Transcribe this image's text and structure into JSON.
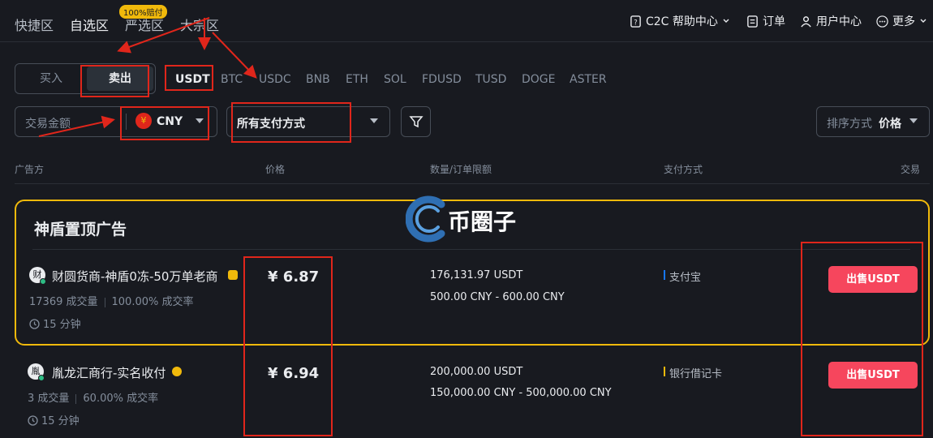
{
  "nav": {
    "tabs": [
      "快捷区",
      "自选区",
      "严选区",
      "大宗区"
    ],
    "badge": "100%赔付",
    "right": {
      "help": "C2C 帮助中心",
      "orders": "订单",
      "user_center": "用户中心",
      "more": "更多"
    }
  },
  "trade_toggle": {
    "buy": "买入",
    "sell": "卖出"
  },
  "coins": [
    "USDT",
    "BTC",
    "USDC",
    "BNB",
    "ETH",
    "SOL",
    "FDUSD",
    "TUSD",
    "DOGE",
    "ASTER"
  ],
  "filters": {
    "amount_label": "交易金额",
    "currency": "CNY",
    "currency_symbol": "¥",
    "payment": "所有支付方式",
    "sort_label": "排序方式",
    "sort_value": "价格"
  },
  "table_headers": {
    "advertiser": "广告方",
    "price": "价格",
    "quantity": "数量/订单限额",
    "payment": "支付方式",
    "trade": "交易"
  },
  "promo_title": "神盾置顶广告",
  "watermark": "币圈子",
  "ads": [
    {
      "avatar": "财",
      "name": "财圆货商-神盾0冻-50万单老商",
      "orders": "17369 成交量",
      "rate": "100.00% 成交率",
      "time": "15 分钟",
      "price": "¥ 6.87",
      "quantity": "176,131.97 USDT",
      "limit": "500.00 CNY - 600.00 CNY",
      "payment": "支付宝",
      "button": "出售USDT"
    },
    {
      "avatar": "胤",
      "name": "胤龙汇商行-实名收付",
      "orders": "3 成交量",
      "rate": "60.00% 成交率",
      "time": "15 分钟",
      "price": "¥ 6.94",
      "quantity": "200,000.00 USDT",
      "limit": "150,000.00 CNY - 500,000.00 CNY",
      "payment": "银行借记卡",
      "button": "出售USDT"
    }
  ],
  "colors": {
    "background": "#181a20",
    "sell_button": "#f6465d",
    "promo_border": "#f0b90b",
    "annotation_red": "#e0261b"
  }
}
